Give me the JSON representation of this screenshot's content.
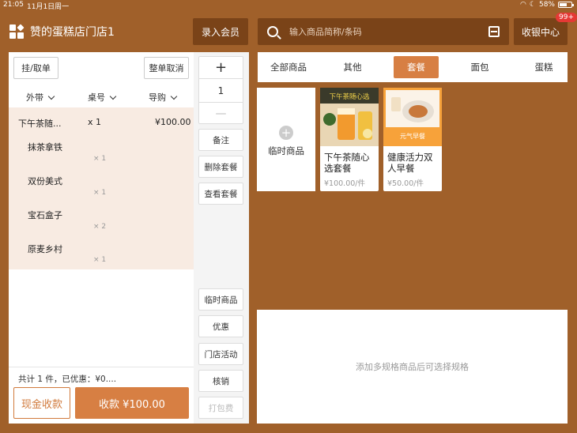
{
  "status_bar": {
    "time": "21:05",
    "date": "11月1日周一",
    "battery": "58%"
  },
  "header": {
    "store_name": "赞的蛋糕店门店1",
    "member_button": "录入会员",
    "search_placeholder": "输入商品简称/条码",
    "cashier_center": "收银中心",
    "notification_badge": "99+"
  },
  "order_panel": {
    "hang_button": "挂/取单",
    "cancel_all_button": "整单取消",
    "columns": {
      "dine_type": "外带",
      "table": "桌号",
      "guide": "导购"
    },
    "main_item": {
      "name": "下午茶随...",
      "qty": "x 1",
      "price": "¥100.00"
    },
    "sub_items": [
      {
        "name": "抹茶拿铁",
        "qty": "× 1"
      },
      {
        "name": "双份美式",
        "qty": "× 1"
      },
      {
        "name": "宝石盒子",
        "qty": "× 2"
      },
      {
        "name": "原麦乡村",
        "qty": "× 1"
      }
    ],
    "summary": "共计 1 件，已优惠：¥0....",
    "cash_button": "现金收款",
    "pay_button": "收款 ¥100.00"
  },
  "actions": {
    "plus": "+",
    "quantity": "1",
    "minus": "—",
    "note": "备注",
    "delete_set": "删除套餐",
    "view_set": "查看套餐",
    "temp_item": "临时商品",
    "discount": "优惠",
    "store_activity": "门店活动",
    "cancel": "核销",
    "packing_fee": "打包费"
  },
  "categories": [
    {
      "label": "全部商品",
      "active": false
    },
    {
      "label": "其他",
      "active": false
    },
    {
      "label": "套餐",
      "active": true
    },
    {
      "label": "面包",
      "active": false
    },
    {
      "label": "蛋糕",
      "active": false
    }
  ],
  "products": {
    "temp_card_label": "临时商品",
    "items": [
      {
        "name": "下午茶随心选套餐",
        "price": "¥100.00/件",
        "image_text": "下午茶随心选"
      },
      {
        "name": "健康活力双人早餐",
        "price": "¥50.00/件",
        "image_text": "元气早餐"
      }
    ]
  },
  "spec_panel": {
    "hint": "添加多规格商品后可选择规格"
  },
  "colors": {
    "background": "#a0602a",
    "dark_brown": "#7a4318",
    "accent": "#d77f43"
  }
}
